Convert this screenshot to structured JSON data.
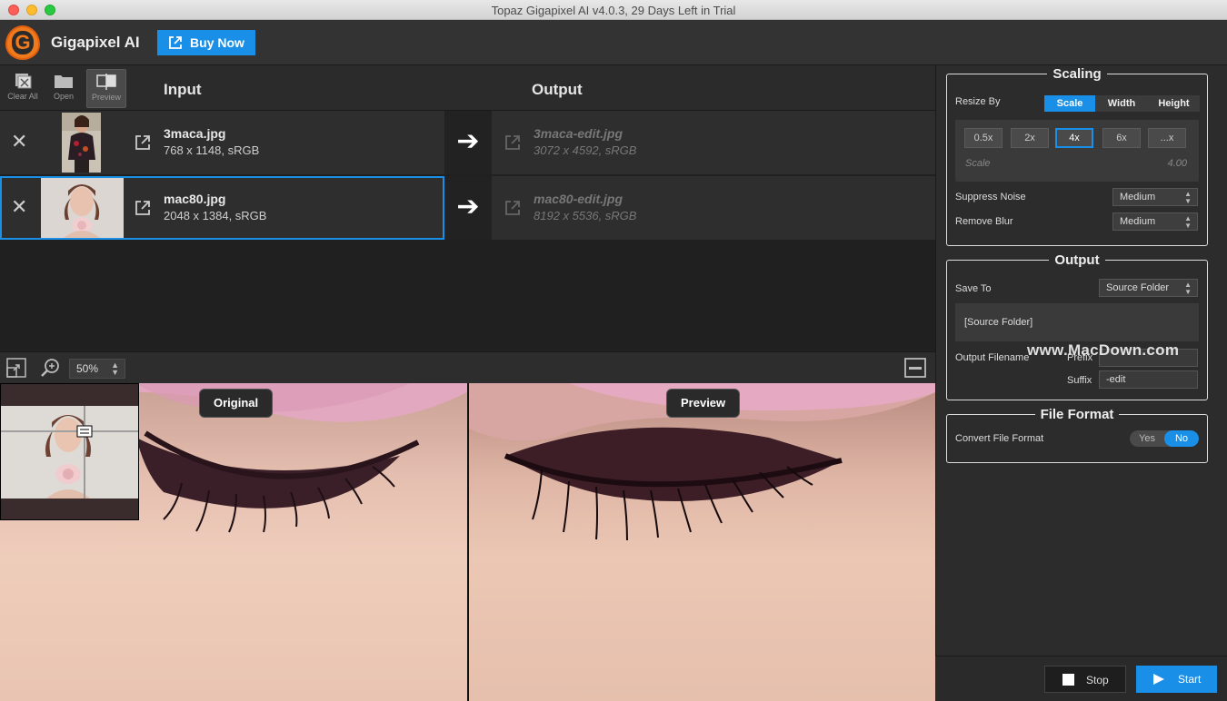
{
  "window": {
    "title": "Topaz Gigapixel AI v4.0.3, 29 Days Left in Trial"
  },
  "header": {
    "app_name": "Gigapixel AI",
    "logo_letter": "G",
    "buy_label": "Buy Now"
  },
  "toolbar": {
    "clear_all": "Clear All",
    "open": "Open",
    "preview": "Preview",
    "input_heading": "Input",
    "output_heading": "Output"
  },
  "files": [
    {
      "name": "3maca.jpg",
      "meta": "768 x 1148, sRGB",
      "out_name": "3maca-edit.jpg",
      "out_meta": "3072 x 4592, sRGB",
      "selected": false
    },
    {
      "name": "mac80.jpg",
      "meta": "2048 x 1384, sRGB",
      "out_name": "mac80-edit.jpg",
      "out_meta": "8192 x 5536, sRGB",
      "selected": true
    }
  ],
  "preview": {
    "zoom": "50%",
    "original_label": "Original",
    "preview_label": "Preview"
  },
  "scaling": {
    "title": "Scaling",
    "resize_by_label": "Resize By",
    "modes": [
      "Scale",
      "Width",
      "Height"
    ],
    "active_mode": "Scale",
    "options": [
      "0.5x",
      "2x",
      "4x",
      "6x",
      "...x"
    ],
    "active_option": "4x",
    "scale_label": "Scale",
    "scale_value": "4.00",
    "suppress_noise_label": "Suppress Noise",
    "suppress_noise_value": "Medium",
    "remove_blur_label": "Remove Blur",
    "remove_blur_value": "Medium"
  },
  "output": {
    "title": "Output",
    "save_to_label": "Save To",
    "save_to_value": "Source Folder",
    "folder_path": "[Source Folder]",
    "filename_label": "Output Filename",
    "prefix_label": "Prefix",
    "prefix_value": "",
    "suffix_label": "Suffix",
    "suffix_value": "-edit"
  },
  "file_format": {
    "title": "File Format",
    "convert_label": "Convert File Format",
    "yes": "Yes",
    "no": "No",
    "active": "No"
  },
  "actions": {
    "stop": "Stop",
    "start": "Start"
  },
  "watermark": "www.MacDown.com",
  "colors": {
    "accent": "#1a8fe8",
    "brand": "#f07a1c"
  }
}
